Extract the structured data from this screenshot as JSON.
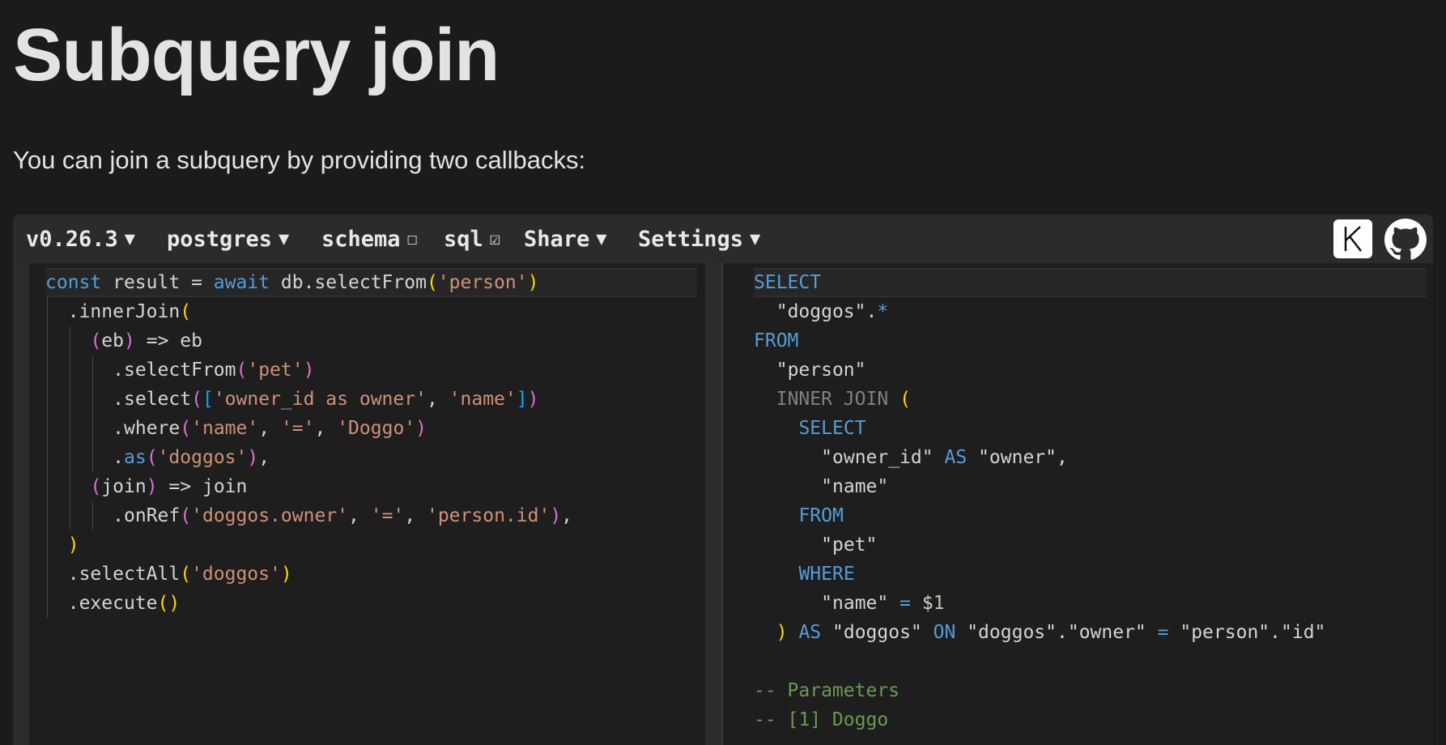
{
  "page": {
    "title": "Subquery join",
    "intro": "You can join a subquery by providing two callbacks:"
  },
  "toolbar": {
    "version": "v0.26.3",
    "dialect": "postgres",
    "schema": "schema",
    "schema_checkbox": "☐",
    "sql": "sql",
    "sql_checkbox": "☑",
    "share": "Share",
    "settings": "Settings",
    "dropdown_arrow": "▼",
    "kysely_logo_letter": "K"
  },
  "editor": {
    "language": "typescript",
    "lines": [
      "const result = await db.selectFrom('person')",
      "  .innerJoin(",
      "    (eb) => eb",
      "      .selectFrom('pet')",
      "      .select(['owner_id as owner', 'name'])",
      "      .where('name', '=', 'Doggo')",
      "      .as('doggos'),",
      "    (join) => join",
      "      .onRef('doggos.owner', '=', 'person.id'),",
      "  )",
      "  .selectAll('doggos')",
      "  .execute()"
    ]
  },
  "output": {
    "language": "sql",
    "lines": [
      "SELECT",
      "  \"doggos\".*",
      "FROM",
      "  \"person\"",
      "  INNER JOIN (",
      "    SELECT",
      "      \"owner_id\" AS \"owner\",",
      "      \"name\"",
      "    FROM",
      "      \"pet\"",
      "    WHERE",
      "      \"name\" = $1",
      "  ) AS \"doggos\" ON \"doggos\".\"owner\" = \"person\".\"id\"",
      "",
      "-- Parameters",
      "-- [1] Doggo"
    ]
  },
  "colors": {
    "background": "#1b1b1d",
    "toolbar": "#2b2b2b",
    "editor": "#1e1e1e",
    "keyword": "#569cd6",
    "string": "#ce9178",
    "bracket_1": "#ffd700",
    "bracket_2": "#da70d6",
    "bracket_3": "#179fff",
    "comment": "#6a9955"
  }
}
